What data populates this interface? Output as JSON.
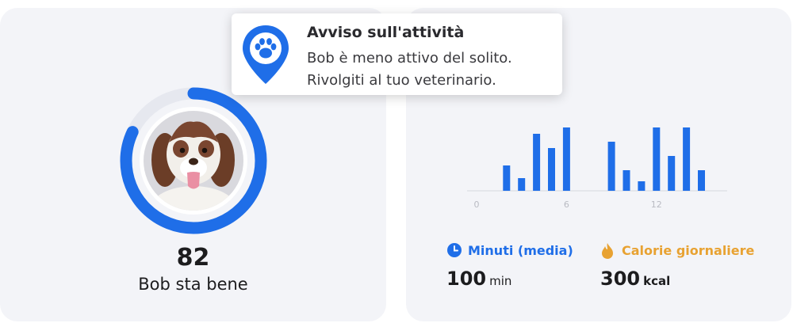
{
  "colors": {
    "accent": "#1f6ee8",
    "orange": "#e8a232",
    "card_bg": "#f3f4f8"
  },
  "notification": {
    "icon": "paw-location-pin-icon",
    "title": "Avviso sull'attività",
    "line1": "Bob è meno attivo del solito.",
    "line2": "Rivolgiti al tuo veterinario."
  },
  "pet": {
    "score": "82",
    "status": "Bob sta bene",
    "score_fraction": 0.82
  },
  "chart_data": {
    "type": "bar",
    "x_ticks": [
      "0",
      "6",
      "12"
    ],
    "x": [
      2,
      3,
      4,
      5,
      6,
      9,
      10,
      11,
      12,
      13,
      14,
      15
    ],
    "values": [
      16,
      8,
      36,
      27,
      40,
      31,
      13,
      6,
      40,
      22,
      40,
      13
    ],
    "ylim": [
      0,
      40
    ],
    "xlim": [
      0,
      15
    ]
  },
  "stats": {
    "minutes": {
      "icon": "clock-icon",
      "label": "Minuti (media)",
      "value": "100",
      "unit": "min"
    },
    "calories": {
      "icon": "flame-icon",
      "label": "Calorie giornaliere",
      "value": "300",
      "unit": "kcal"
    }
  }
}
